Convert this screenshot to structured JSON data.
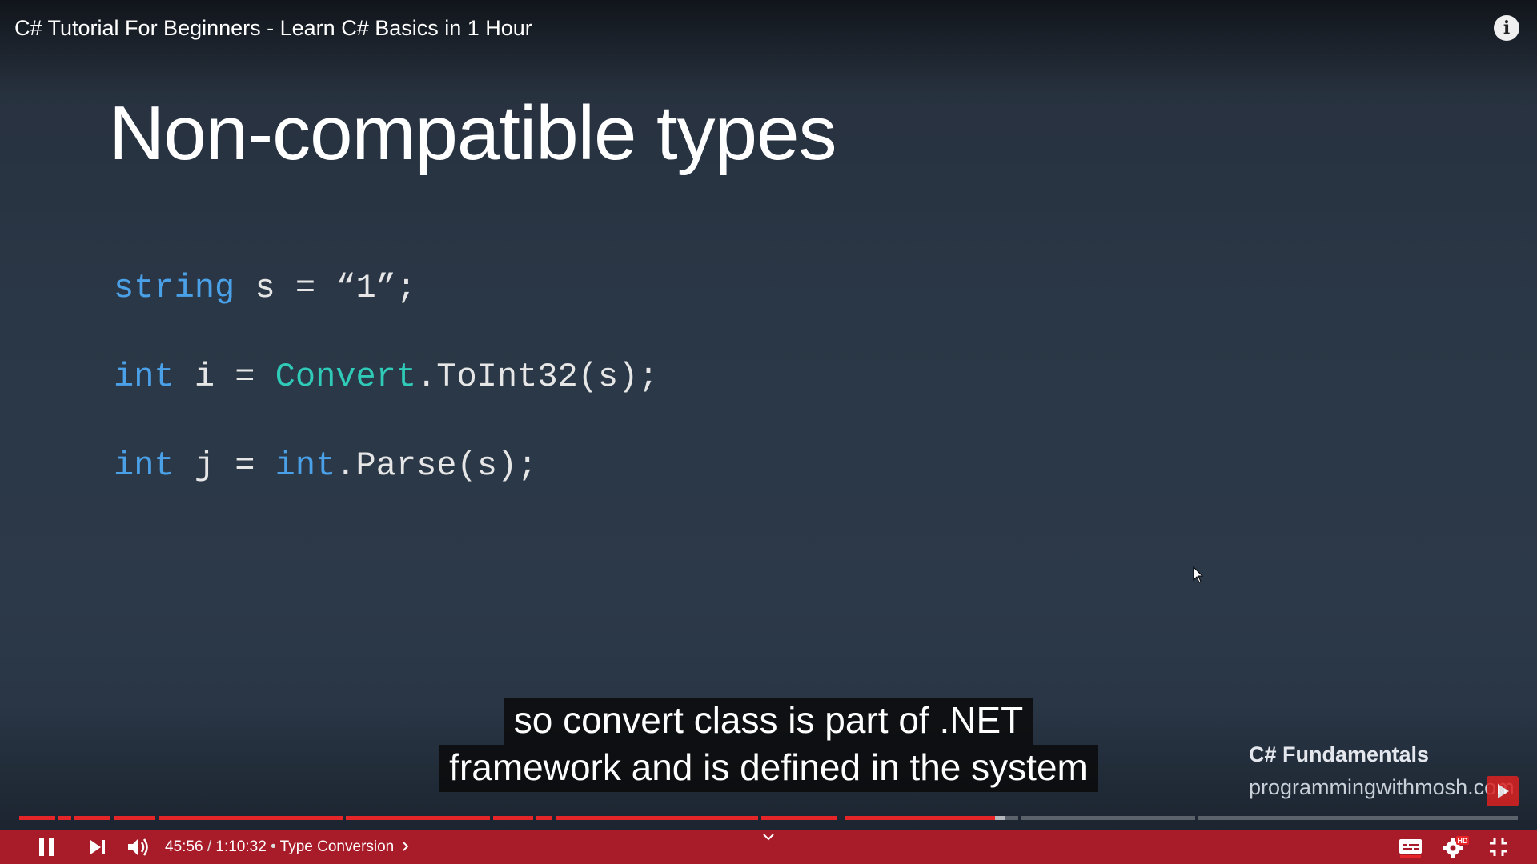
{
  "video": {
    "title": "C# Tutorial For Beginners - Learn C# Basics in 1 Hour"
  },
  "slide": {
    "title": "Non-compatible types",
    "code": [
      [
        {
          "t": "string",
          "c": "kw"
        },
        {
          "t": " s = “1”;",
          "c": ""
        }
      ],
      [
        {
          "t": "int",
          "c": "kw"
        },
        {
          "t": " i = ",
          "c": ""
        },
        {
          "t": "Convert",
          "c": "cls"
        },
        {
          "t": ".ToInt32(s);",
          "c": ""
        }
      ],
      [
        {
          "t": "int",
          "c": "kw"
        },
        {
          "t": " j = ",
          "c": ""
        },
        {
          "t": "int",
          "c": "kw"
        },
        {
          "t": ".Parse(s);",
          "c": ""
        }
      ]
    ]
  },
  "caption": {
    "line1": "so convert class is part of .NET",
    "line2": "framework and is defined in the system"
  },
  "watermark": {
    "title": "C# Fundamentals",
    "site": "programmingwithmosh.com"
  },
  "player": {
    "current_time": "45:56",
    "separator": " / ",
    "duration": "1:10:32",
    "chapter_separator": " • ",
    "chapter": "Type Conversion",
    "progress_fraction": 0.651,
    "buffered_fraction": 0.658,
    "chapter_breaks": [
      0.026,
      0.037,
      0.063,
      0.093,
      0.218,
      0.316,
      0.345,
      0.358,
      0.495,
      0.548,
      0.551,
      0.669,
      0.787
    ],
    "hd_badge": "HD",
    "icons": {
      "play_pause": "pause-icon",
      "next": "next-icon",
      "volume": "volume-icon",
      "captions": "subtitles-icon",
      "settings": "gear-icon",
      "fullscreen": "exit-fullscreen-icon",
      "info": "info-icon"
    },
    "colors": {
      "progress": "#e52528",
      "keyword": "#4ba1e8",
      "class_name": "#2fcab8"
    }
  }
}
